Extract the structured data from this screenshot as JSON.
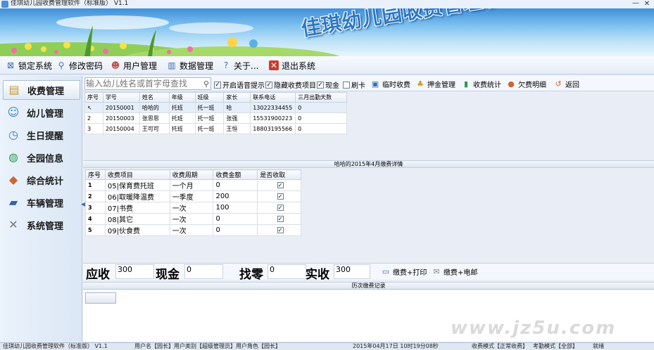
{
  "window": {
    "title": "佳琪幼儿园收费管理软件（标准版） V1.1",
    "banner_title": "佳琪幼儿园收费管理软件",
    "close_glyph": "✕",
    "minimize_glyph": "—"
  },
  "menu": [
    {
      "label": "锁定系统",
      "icon": "lock-icon"
    },
    {
      "label": "修改密码",
      "icon": "key-icon"
    },
    {
      "label": "用户管理",
      "icon": "users-icon"
    },
    {
      "label": "数据管理",
      "icon": "database-icon"
    },
    {
      "label": "关于...",
      "icon": "help-icon"
    },
    {
      "label": "退出系统",
      "icon": "exit-icon"
    }
  ],
  "sidebar": {
    "items": [
      {
        "label": "收费管理",
        "icon": "money-icon",
        "active": true
      },
      {
        "label": "幼儿管理",
        "icon": "children-icon"
      },
      {
        "label": "生日提醒",
        "icon": "clock-icon"
      },
      {
        "label": "全园信息",
        "icon": "globe-icon"
      },
      {
        "label": "综合统计",
        "icon": "chart-icon"
      },
      {
        "label": "车辆管理",
        "icon": "car-icon"
      },
      {
        "label": "系统管理",
        "icon": "tools-icon"
      }
    ]
  },
  "toolbar": {
    "search_placeholder": "输入幼儿姓名或首字母查找",
    "checkboxes": [
      {
        "label": "开启语音提示",
        "checked": true
      },
      {
        "label": "隐藏收费项目",
        "checked": true
      },
      {
        "label": "现金",
        "checked": true
      },
      {
        "label": "刷卡",
        "checked": false
      }
    ],
    "buttons": [
      {
        "label": "临时收费",
        "icon": "temp-fee-icon"
      },
      {
        "label": "押金管理",
        "icon": "deposit-icon"
      },
      {
        "label": "收费统计",
        "icon": "bar-chart-icon"
      },
      {
        "label": "欠费明细",
        "icon": "arrears-icon"
      },
      {
        "label": "返回",
        "icon": "back-icon"
      }
    ]
  },
  "students_table": {
    "headers": [
      "序号",
      "学号",
      "姓名",
      "年级",
      "班级",
      "家长",
      "联系电话",
      "三月出勤天数"
    ],
    "rows": [
      [
        "",
        "20150001",
        "哈哈的",
        "托班",
        "托一班",
        "哈",
        "13022334455",
        "0"
      ],
      [
        "2",
        "20150003",
        "张思思",
        "托班",
        "托一班",
        "张强",
        "15531900223",
        "0"
      ],
      [
        "3",
        "20150004",
        "王可可",
        "托班",
        "托一班",
        "王恒",
        "18803195566",
        "0"
      ]
    ]
  },
  "detail_title": "哈哈的2015年4月缴费详情",
  "fee_table": {
    "headers": [
      "序号",
      "收费项目",
      "收费周期",
      "收费金额",
      "是否收取"
    ],
    "rows": [
      {
        "idx": "1",
        "item": "05|保育费托班",
        "period": "一个月",
        "amount": "0",
        "checked": true
      },
      {
        "idx": "2",
        "item": "06|取暖降温费",
        "period": "一季度",
        "amount": "200",
        "checked": true
      },
      {
        "idx": "3",
        "item": "07|书费",
        "period": "一次",
        "amount": "100",
        "checked": true
      },
      {
        "idx": "4",
        "item": "08|其它",
        "period": "一次",
        "amount": "0",
        "checked": true
      },
      {
        "idx": "5",
        "item": "09|伙食费",
        "period": "一次",
        "amount": "0",
        "checked": true
      }
    ]
  },
  "summary": {
    "receivable_label": "应收",
    "receivable_value": "300",
    "cash_label": "现金",
    "cash_value": "0",
    "change_label": "找零",
    "change_value": "0",
    "actual_label": "实收",
    "actual_value": "300",
    "pay_print_label": "缴费+打印",
    "pay_sms_label": "缴费+电邮"
  },
  "history_title": "历次缴费记录",
  "watermark": "www.jz5u.com",
  "status": {
    "app": "佳琪幼儿园收费管理软件（标准版） V1.1",
    "user": "用户名【园长】用户类别【超级管理员】用户角色【园长】",
    "datetime": "2015年04月17日 10时19分08秒",
    "mode": "收费模式【正常收费】",
    "attendance": "考勤模式【全部】",
    "state": "就绪"
  }
}
